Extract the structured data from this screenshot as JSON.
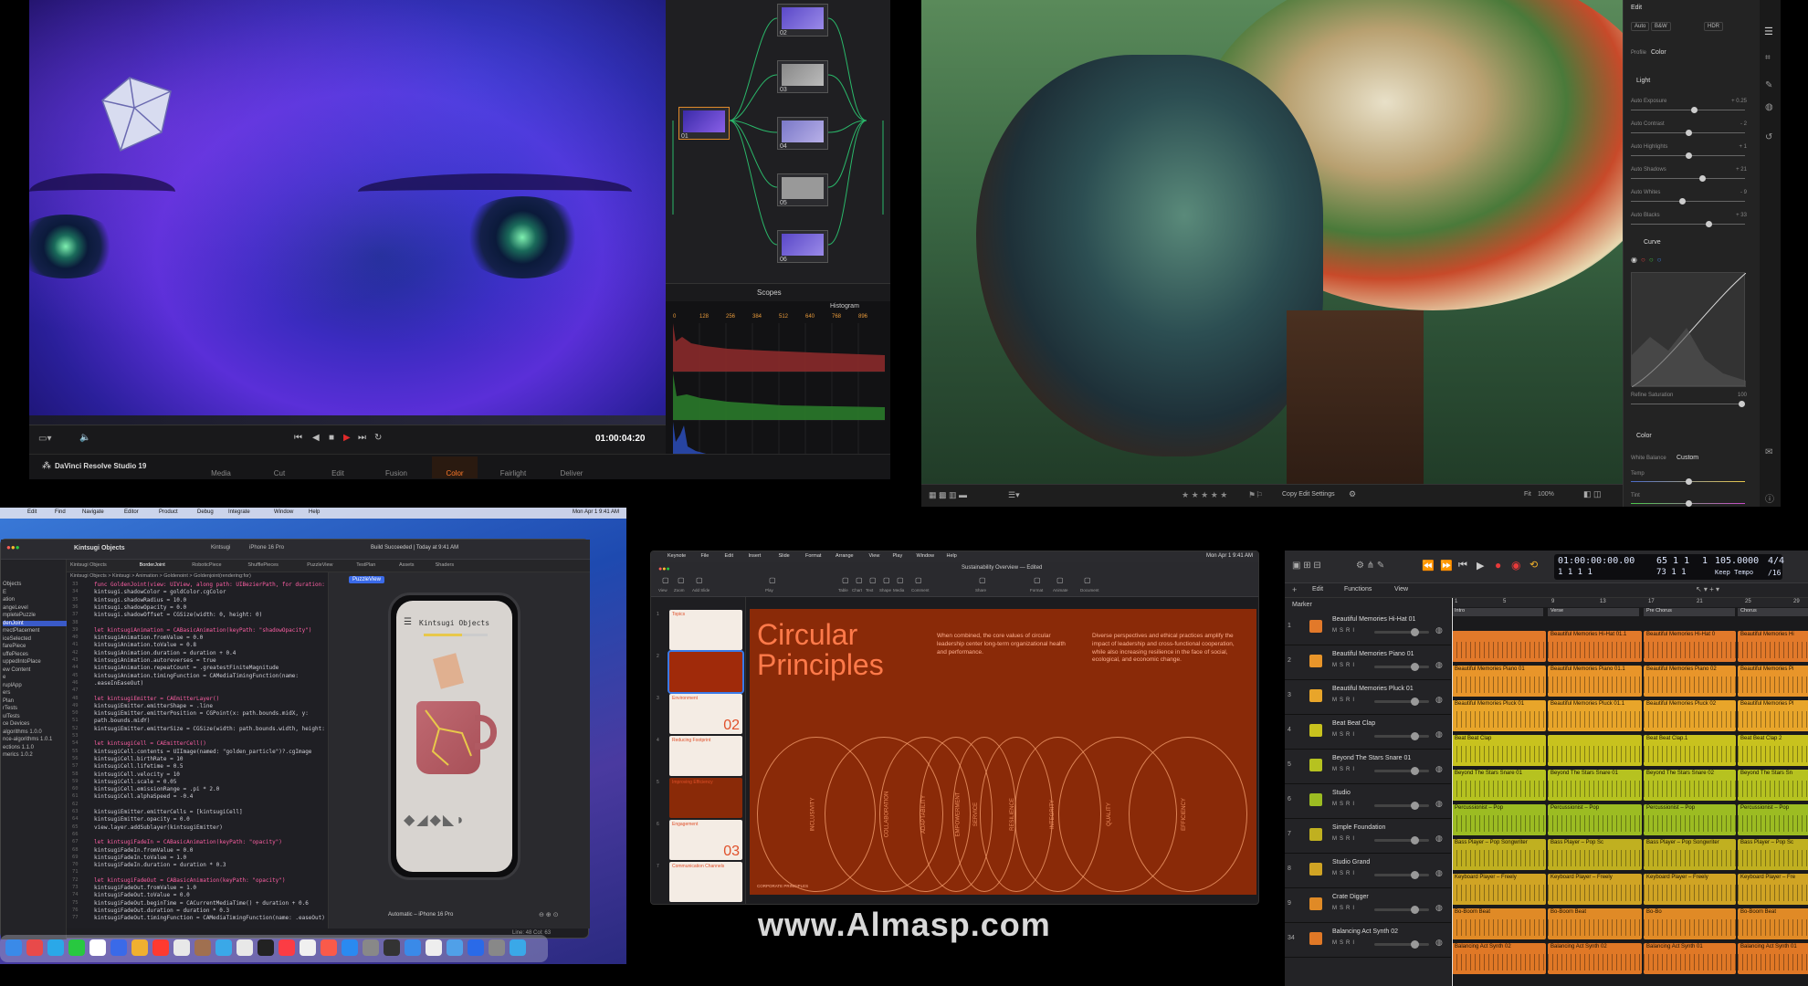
{
  "davinci": {
    "app_title": "DaVinci Resolve Studio 19",
    "timecode": "01:00:04:20",
    "scopes_label": "Scopes",
    "histogram_label": "Histogram",
    "histogram_ticks": [
      "0",
      "128",
      "256",
      "384",
      "512",
      "640",
      "768",
      "896"
    ],
    "nodes": [
      {
        "label": "02"
      },
      {
        "label": "03"
      },
      {
        "label": "04"
      },
      {
        "label": "05"
      },
      {
        "label": "06"
      },
      {
        "label": "01"
      }
    ],
    "pages": [
      "Media",
      "Cut",
      "Edit",
      "Fusion",
      "Color",
      "Fairlight",
      "Deliver"
    ],
    "active_page": "Color",
    "accent": "#ff7a2a"
  },
  "lightroom": {
    "panel_title": "Edit",
    "top_buttons": [
      "Auto",
      "B&W",
      "HDR"
    ],
    "profile_label": "Profile",
    "profile_value": "Color",
    "light_section": "Light",
    "sliders": [
      {
        "label": "Auto Exposure",
        "value": "+ 0.25",
        "pos": 0.55
      },
      {
        "label": "Auto Contrast",
        "value": "- 2",
        "pos": 0.5
      },
      {
        "label": "Auto Highlights",
        "value": "+ 1",
        "pos": 0.5
      },
      {
        "label": "Auto Shadows",
        "value": "+ 21",
        "pos": 0.62
      },
      {
        "label": "Auto Whites",
        "value": "- 9",
        "pos": 0.45
      },
      {
        "label": "Auto Blacks",
        "value": "+ 33",
        "pos": 0.68
      }
    ],
    "curve_section": "Curve",
    "refine_saturation": "Refine Saturation",
    "refine_value": "100",
    "color_section": "Color",
    "white_balance_label": "White Balance",
    "white_balance_value": "Custom",
    "temp_label": "Temp",
    "tint_label": "Tint",
    "copy_edit_settings": "Copy Edit Settings",
    "fit_label": "Fit",
    "zoom_value": "100%"
  },
  "xcode": {
    "menu": [
      "Edit",
      "Find",
      "Navigate",
      "Editor",
      "Product",
      "Debug",
      "Integrate",
      "Window",
      "Help"
    ],
    "project": "Kintsugi Objects",
    "scheme": "Kintsugi",
    "device": "iPhone 16 Pro",
    "build_status": "Build Succeeded | Today at 9:41 AM",
    "tabs": [
      "Kintsugi Objects",
      "BorderJoint",
      "RoboticPiece",
      "ShufflePieces",
      "PuzzleView",
      "TestPlan",
      "Assets",
      "Shaders"
    ],
    "breadcrumb": "Kintsugi Objects > Kintsugi > Animation > Goldenoint > Goldenjoint(rendering:for)",
    "nav_items": [
      "Objects",
      "E",
      "ation",
      "angeLevel",
      "mpletePuzzle",
      "denJoint",
      "rrectPlacement",
      "iceSelected",
      "farePiece",
      "uffePieces",
      "uppedIntoPlace",
      "ew Content",
      "e",
      "ruplApp",
      "ers",
      "Plan",
      "rTests",
      "ulTests",
      "ce Devices",
      "algorithms 1.0.0",
      "nce-algorithms 1.0.1",
      "ections 1.1.0",
      "merics 1.0.2"
    ],
    "code_lines": [
      "func GoldenJoint(view: UIView, along path: UIBezierPath, for duration: ",
      "  kintsugi.shadowColor = goldColor.cgColor",
      "  kintsugi.shadowRadius = 10.0",
      "  kintsugi.shadowOpacity = 0.0",
      "  kintsugi.shadowOffset = CGSize(width: 0, height: 0)",
      "",
      "  let kintsugiAnimation = CABasicAnimation(keyPath: \"shadowOpacity\")",
      "  kintsugiAnimation.fromValue = 0.0",
      "  kintsugiAnimation.toValue = 0.8",
      "  kintsugiAnimation.duration = duration + 0.4",
      "  kintsugiAnimation.autoreverses = true",
      "  kintsugiAnimation.repeatCount = .greatestFiniteMagnitude",
      "  kintsugiAnimation.timingFunction = CAMediaTimingFunction(name:",
      "      .easeInEaseOut)",
      "",
      "  let kintsugiEmitter = CAEmitterLayer()",
      "  kintsugiEmitter.emitterShape = .line",
      "  kintsugiEmitter.emitterPosition = CGPoint(x: path.bounds.midX, y:",
      "      path.bounds.midY)",
      "  kintsugiEmitter.emitterSize = CGSize(width: path.bounds.width, height:",
      "",
      "  let kintsugiCell = CAEmitterCell()",
      "  kintsugiCell.contents = UIImage(named: \"golden_particle\")?.cgImage",
      "  kintsugiCell.birthRate = 10",
      "  kintsugiCell.lifetime = 0.5",
      "  kintsugiCell.velocity = 10",
      "  kintsugiCell.scale = 0.05",
      "  kintsugiCell.emissionRange = .pi * 2.0",
      "  kintsugiCell.alphaSpeed = -0.4",
      "",
      "  kintsugiEmitter.emitterCells = [kintsugiCell]",
      "  kintsugiEmitter.opacity = 0.0",
      "  view.layer.addSublayer(kintsugiEmitter)",
      "",
      "  let kintsugiFadeIn = CABasicAnimation(keyPath: \"opacity\")",
      "  kintsugiFadeIn.fromValue = 0.0",
      "  kintsugiFadeIn.toValue = 1.0",
      "  kintsugiFadeIn.duration = duration * 0.3",
      "",
      "  let kintsugiFadeOut = CABasicAnimation(keyPath: \"opacity\")",
      "  kintsugiFadeOut.fromValue = 1.0",
      "  kintsugiFadeOut.toValue = 0.0",
      "  kintsugiFadeOut.beginTime = CACurrentMediaTime() + duration + 0.6",
      "  kintsugiFadeOut.duration = duration * 0.3",
      "  kintsugiFadeOut.timingFunction = CAMediaTimingFunction(name: .easeOut)"
    ],
    "preview_title": "Kintsugi Objects",
    "preview_badge": "PuzzleView",
    "preview_device": "Automatic – iPhone 16 Pro",
    "status_line": "Line: 48  Col: 63",
    "clock": "Mon Apr 1  9:41 AM"
  },
  "keynote": {
    "menu": [
      "Keynote",
      "File",
      "Edit",
      "Insert",
      "Slide",
      "Format",
      "Arrange",
      "View",
      "Play",
      "Window",
      "Help"
    ],
    "doc_title": "Sustainability Overview — Edited",
    "clock": "Mon Apr 1  9:41 AM",
    "toolbar": [
      "View",
      "Zoom",
      "Add Slide",
      "Play",
      "Table",
      "Chart",
      "Text",
      "Shape",
      "Media",
      "Comment",
      "Share",
      "Format",
      "Animate",
      "Document"
    ],
    "slide_title_1": "Circular",
    "slide_title_2": "Principles",
    "body_left": "When combined, the core values of circular leadership center long-term organizational health and performance.",
    "body_right": "Diverse perspectives and ethical practices amplify the impact of leadership and cross-functional cooperation, while also increasing resilience in the face of social, ecological, and economic change.",
    "rings": [
      "INCLUSIVITY",
      "COLLABORATION",
      "ADAPTABILITY",
      "EMPOWERMENT",
      "SERVICE",
      "RESILIENCE",
      "INTEGRITY",
      "QUALITY",
      "EFFICIENCY"
    ],
    "footer": "CORPORATE PRINCIPLES",
    "thumbs": [
      {
        "title": "Topics",
        "num": ""
      },
      {
        "title": "",
        "num": ""
      },
      {
        "title": "Environment",
        "num": "02"
      },
      {
        "title": "Reducing Footprint",
        "num": ""
      },
      {
        "title": "Improving Efficiency",
        "num": ""
      },
      {
        "title": "Engagement",
        "num": "03"
      },
      {
        "title": "Communication Channels",
        "num": ""
      }
    ]
  },
  "logic": {
    "lcd_time": "01:00:00:00.00",
    "lcd_bars": "1  1  1      1",
    "lcd_pos": "65  1  1",
    "lcd_pos2": "73  1  1",
    "lcd_beat": "1",
    "tempo": "105.0000",
    "tempo_label": "Keep Tempo",
    "signature": "4/4",
    "division": "/16",
    "menu": [
      "Edit",
      "Functions",
      "View"
    ],
    "marker_label": "Marker",
    "ruler": [
      "1",
      "5",
      "9",
      "13",
      "17",
      "21",
      "25",
      "29"
    ],
    "sections": [
      "Intro",
      "Verse",
      "Pre Chorus",
      "Chorus"
    ],
    "tracks": [
      {
        "num": "1",
        "name": "Beautiful Memories Hi-Hat 01",
        "color": "#e2792a"
      },
      {
        "num": "2",
        "name": "Beautiful Memories Piano 01",
        "color": "#e8952a"
      },
      {
        "num": "3",
        "name": "Beautiful Memories Pluck 01",
        "color": "#e8a52a"
      },
      {
        "num": "4",
        "name": "Beat Beat Clap",
        "color": "#c8c21e"
      },
      {
        "num": "5",
        "name": "Beyond The Stars Snare 01",
        "color": "#b6c220"
      },
      {
        "num": "6",
        "name": "Studio",
        "color": "#9cbc22"
      },
      {
        "num": "7",
        "name": "Simple Foundation",
        "color": "#c0b020"
      },
      {
        "num": "8",
        "name": "Studio Grand",
        "color": "#d0a424"
      },
      {
        "num": "9",
        "name": "Crate Digger",
        "color": "#e08a26"
      },
      {
        "num": "34",
        "name": "Balancing Act Synth 02",
        "color": "#e07826"
      }
    ],
    "regions": [
      [
        "",
        "Beautiful Memories Hi-Hat 01.1",
        "Beautiful Memories Hi-Hat 0",
        "Beautiful Memories Hi"
      ],
      [
        "Beautiful Memories Piano 01",
        "Beautiful Memories Piano 01.1",
        "Beautiful Memories Piano 02",
        "Beautiful Memories Pi"
      ],
      [
        "Beautiful Memories Pluck 01",
        "Beautiful Memories Pluck 01.1",
        "Beautiful Memories Pluck 02",
        "Beautiful Memories Pl"
      ],
      [
        "Beat Beat Clap",
        "",
        "Beat Beat Clap.1",
        "Beat Beat Clap 2"
      ],
      [
        "Beyond The Stars Snare 01",
        "Beyond The Stars Snare 01",
        "Beyond The Stars Snare 02",
        "Beyond The Stars Sn"
      ],
      [
        "Percussionist – Pop",
        "Percussionist – Pop",
        "Percussionist – Pop",
        "Percussionist – Pop"
      ],
      [
        "Bass Player – Pop Songwriter",
        "Bass Player – Pop Sc",
        "Bass Player – Pop Songwriter",
        "Bass Player – Pop Sc"
      ],
      [
        "Keyboard Player – Freely",
        "Keyboard Player – Freely",
        "Keyboard Player – Freely",
        "Keyboard Player – Fre"
      ],
      [
        "Bo-Boom Beat",
        "Bo-Boom Beat",
        "Bo-Bo",
        "Bo-Boom Beat"
      ],
      [
        "Balancing Act Synth 02",
        "Balancing Act Synth 02",
        "Balancing Act Synth 01",
        "Balancing Act Synth 01"
      ]
    ]
  },
  "watermark": "www.Almasp.com"
}
